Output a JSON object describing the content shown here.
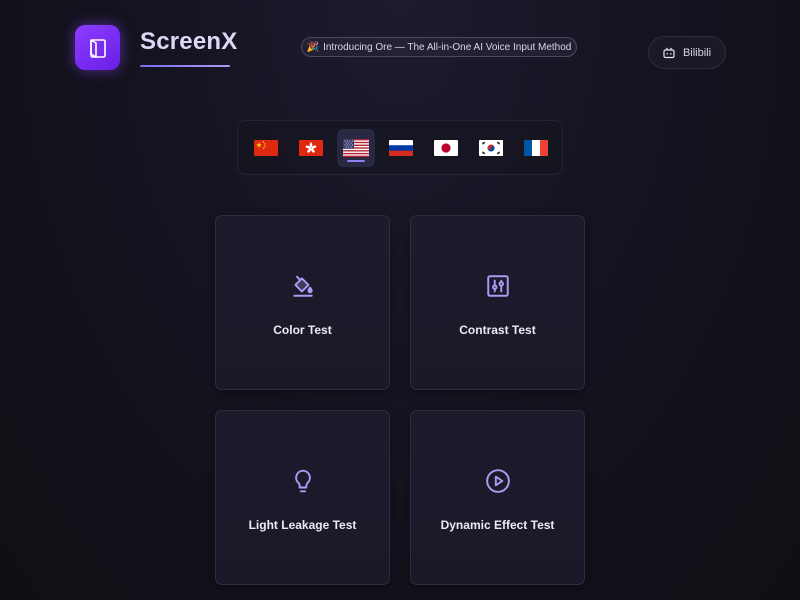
{
  "header": {
    "brand": "ScreenX",
    "announcement": "Introducing Ore — The All-in-One AI Voice Input Method",
    "announcement_icon": "party-popper-icon",
    "social_label": "Bilibili",
    "social_icon": "bilibili-tv-icon"
  },
  "languages": [
    {
      "code": "zh-CN",
      "icon": "flag-china-icon"
    },
    {
      "code": "zh-HK",
      "icon": "flag-hong-kong-icon"
    },
    {
      "code": "en-US",
      "icon": "flag-usa-icon",
      "selected": true
    },
    {
      "code": "ru",
      "icon": "flag-russia-icon"
    },
    {
      "code": "ja",
      "icon": "flag-japan-icon"
    },
    {
      "code": "ko",
      "icon": "flag-korea-icon"
    },
    {
      "code": "fr",
      "icon": "flag-france-icon"
    }
  ],
  "cards": [
    {
      "label": "Color Test",
      "icon": "paint-bucket-icon"
    },
    {
      "label": "Contrast Test",
      "icon": "sliders-icon"
    },
    {
      "label": "Light Leakage Test",
      "icon": "lightbulb-icon"
    },
    {
      "label": "Dynamic Effect Test",
      "icon": "play-circle-icon"
    }
  ],
  "colors": {
    "accent": "#8b3dff",
    "icon": "#a99cf5",
    "underline": "#7d6df0"
  }
}
